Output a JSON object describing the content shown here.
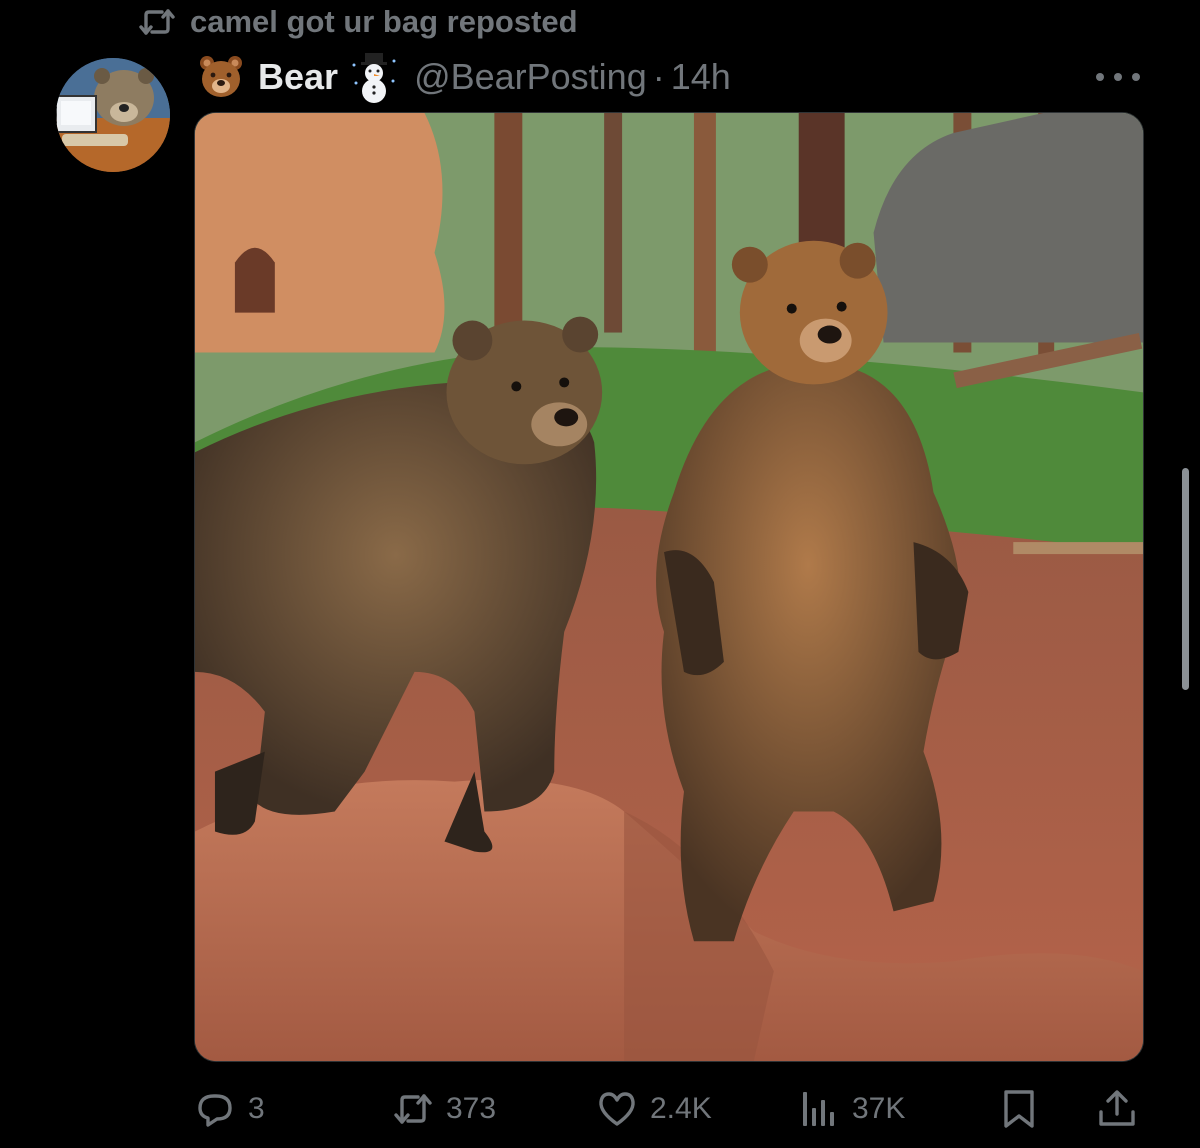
{
  "repost": {
    "text": "camel got ur bag reposted",
    "icon": "repost-icon"
  },
  "post": {
    "author_name": "Bear",
    "author_emoji": "bear-face-emoji",
    "badge_emoji": "snowman-emoji",
    "handle": "@BearPosting",
    "separator": "·",
    "time": "14h",
    "media": {
      "description_icon": "photo",
      "subject": "two brown bears on red rock, one standing on hind legs"
    }
  },
  "actions": {
    "replies": "3",
    "reposts": "373",
    "likes": "2.4K",
    "views": "37K"
  },
  "colors": {
    "background": "#000000",
    "text": "#e7e9ea",
    "muted": "#71767b"
  }
}
